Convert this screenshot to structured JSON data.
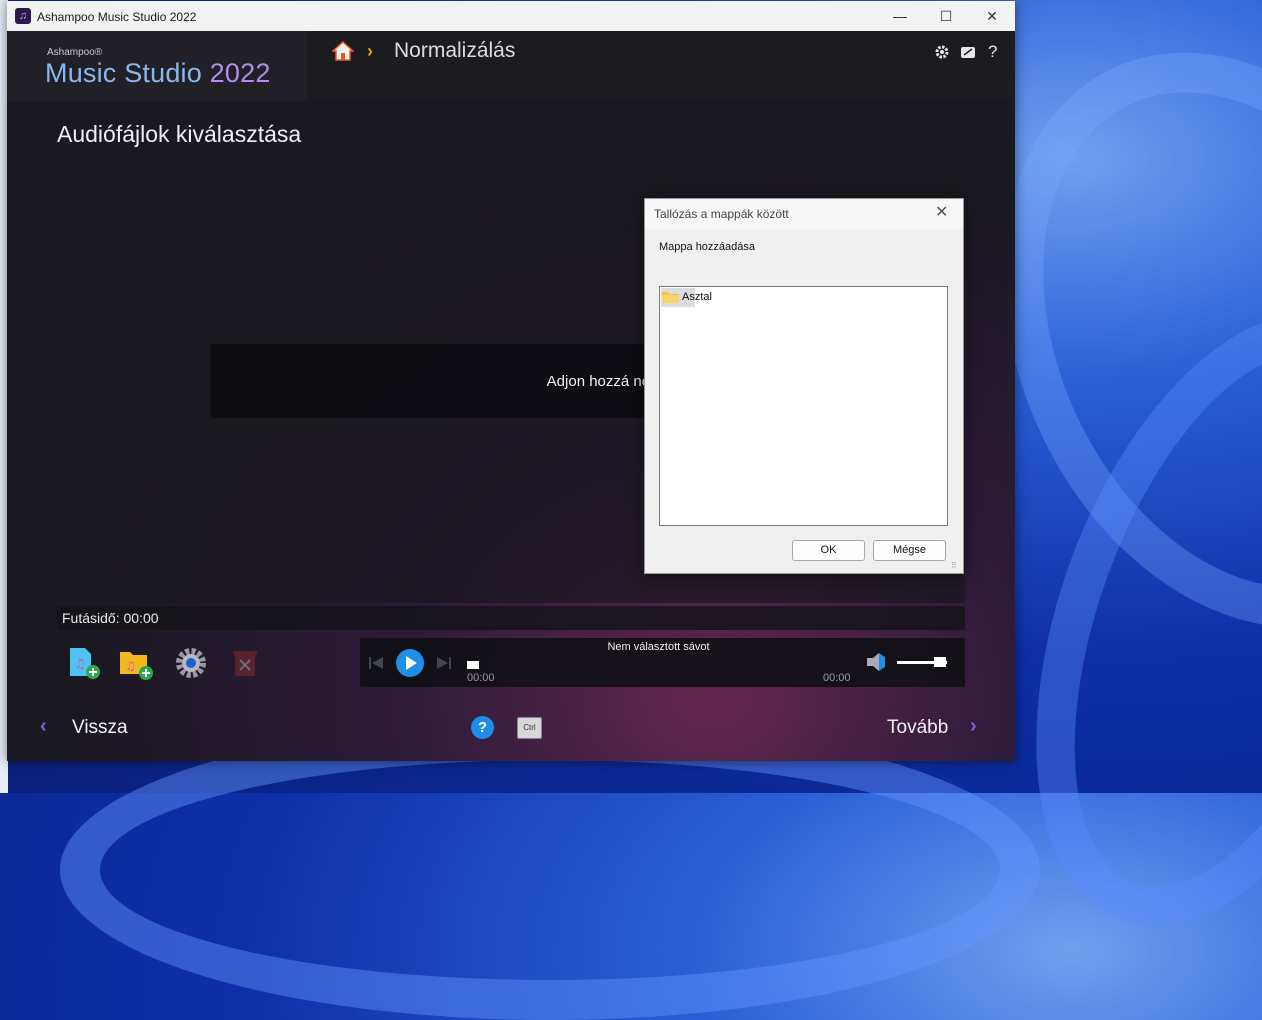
{
  "window": {
    "title": "Ashampoo Music Studio 2022",
    "minimize_glyph": "—",
    "maximize_glyph": "☐",
    "close_glyph": "✕"
  },
  "header": {
    "brand_small": "Ashampoo®",
    "brand_name": "Music Studio ",
    "brand_year": "2022",
    "breadcrumb_separator": "›",
    "page_name": "Normalizálás",
    "icons": [
      "gear-icon",
      "feedback-icon",
      "help-icon"
    ],
    "help_glyph": "?"
  },
  "main": {
    "title": "Audiófájlok kiválasztása",
    "empty_message": "Adjon hozzá normalizálandó fájlokat.",
    "runtime_label": "Futásidő: 00:00"
  },
  "toolbar": {
    "items": [
      "add-files-icon",
      "add-folder-icon",
      "settings-icon",
      "delete-icon"
    ]
  },
  "player": {
    "track_label": "Nem választott sávot",
    "time_current": "00:00",
    "time_total": "00:00"
  },
  "nav": {
    "back_chevron": "‹",
    "back_label": "Vissza",
    "next_label": "Tovább",
    "next_chevron": "›",
    "help_glyph": "?",
    "ctrl_label": "Ctrl"
  },
  "dialog": {
    "title": "Tallózás a mappák között",
    "close_glyph": "✕",
    "label": "Mappa hozzáadása",
    "tree_items": [
      "Asztal"
    ],
    "ok_label": "OK",
    "cancel_label": "Mégse"
  },
  "colors": {
    "accent_purple": "#8a5fe0",
    "brand_blue": "#8bb7f0",
    "brand_year": "#b48cf0",
    "crumb_chevron": "#e6a317",
    "play_blue": "#1e8fe8"
  }
}
